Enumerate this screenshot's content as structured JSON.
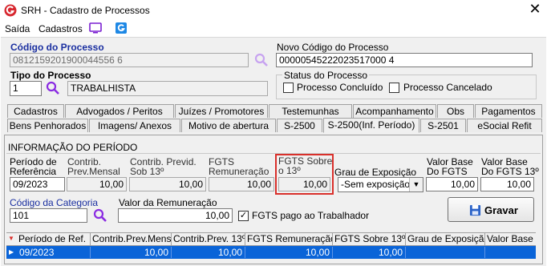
{
  "window": {
    "title": "SRH - Cadastro de Processos",
    "close_glyph": "✕"
  },
  "menu": {
    "items": [
      "Saída",
      "Cadastros"
    ]
  },
  "codigo_processo": {
    "label": "Código do Processo",
    "value": "0812159201900044556 6"
  },
  "novo_codigo": {
    "label": "Novo Código do Processo",
    "value": "00000545222023517000 4"
  },
  "tipo_processo": {
    "label": "Tipo do Processo",
    "code": "1",
    "description": "TRABALHISTA"
  },
  "status_processo": {
    "title": "Status do Processo",
    "concluido_label": "Processo Concluído",
    "cancelado_label": "Processo Cancelado"
  },
  "tabs_row1": [
    "Cadastros",
    "Advogados / Peritos",
    "Juízes / Promotores",
    "Testemunhas",
    "Acompanhamento",
    "Obs",
    "Pagamentos"
  ],
  "tabs_row2": [
    "Bens Penhorados",
    "Imagens/ Anexos",
    "Motivo de abertura",
    "S-2500",
    "S-2500(Inf. Período)",
    "S-2501",
    "eSocial Refit"
  ],
  "active_tab": "S-2500(Inf. Período)",
  "section_title": "INFORMAÇÃO DO PERÍODO",
  "fields": {
    "periodo_ref": {
      "label1": "Período de",
      "label2": "Referência",
      "value": "09/2023"
    },
    "contrib_prev_mensal": {
      "label1": "Contrib.",
      "label2": "Prev.Mensal",
      "value": "10,00"
    },
    "contrib_previd_13": {
      "label1": "Contrib. Previd.",
      "label2": "Sob 13º",
      "value": "10,00"
    },
    "fgts_remuneracao": {
      "label1": "FGTS",
      "label2": "Remuneração",
      "value": "10,00"
    },
    "fgts_sobre_13": {
      "label1": "FGTS Sobre",
      "label2": "o 13º",
      "value": "10,00"
    },
    "grau_exposicao": {
      "label": "Grau de Exposição",
      "value": "-Sem exposição a"
    },
    "valor_base_fgts": {
      "label1": "Valor Base",
      "label2": "Do FGTS",
      "value": "10,00"
    },
    "valor_base_fgts_13": {
      "label1": "Valor Base",
      "label2": "Do FGTS 13º",
      "value": "10,00"
    },
    "codigo_categoria": {
      "label": "Código da Categoria",
      "value": "101"
    },
    "valor_remuneracao": {
      "label": "Valor da Remuneração",
      "value": "10,00"
    },
    "fgts_pago": {
      "label": "FGTS pago ao Trabalhador",
      "checked": true
    }
  },
  "buttons": {
    "gravar": "Gravar"
  },
  "grid": {
    "columns": [
      "Período de Ref.",
      "Contrib.Prev.Mensal",
      "Contrib.Prev. 13º",
      "FGTS Remuneração",
      "FGTS Sobre 13º",
      "Grau de Exposição",
      "Valor Base"
    ],
    "rows": [
      [
        "09/2023",
        "10,00",
        "10,00",
        "10,00",
        "10,00",
        "",
        ""
      ]
    ]
  },
  "colors": {
    "highlight_border": "#d9302b",
    "selected_row": "#0a64d8",
    "label_blue": "#1a2fa0",
    "search_icon": "#8a2be2"
  }
}
